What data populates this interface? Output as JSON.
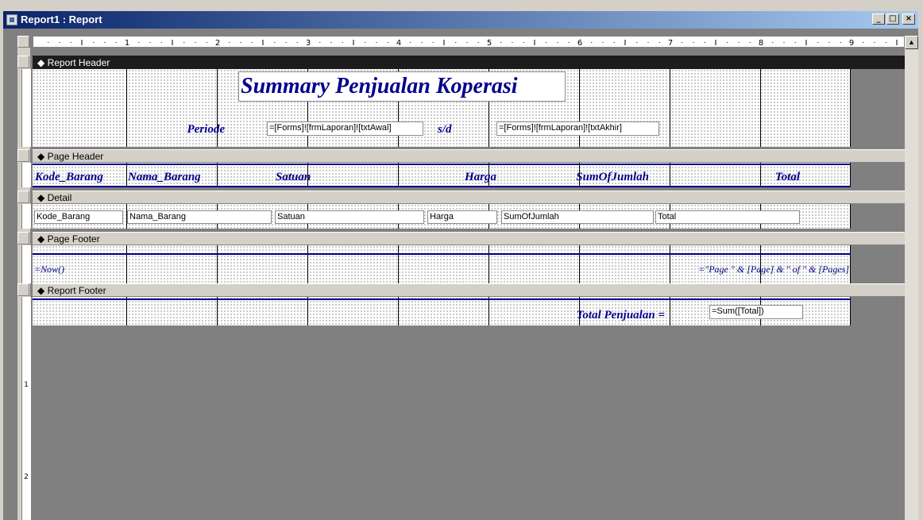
{
  "window": {
    "title": "Report1 : Report",
    "buttons": {
      "minimize": "_",
      "maximize": "□",
      "close": "×"
    }
  },
  "ruler": {
    "numbers": [
      "1",
      "2",
      "3",
      "4",
      "5",
      "6",
      "7",
      "8",
      "9"
    ]
  },
  "vertical_ruler": {
    "numbers": [
      "1",
      "2"
    ]
  },
  "sections": {
    "report_header": "Report Header",
    "page_header": "Page Header",
    "detail": "Detail",
    "page_footer": "Page Footer",
    "report_footer": "Report Footer"
  },
  "report_header": {
    "title": "Summary Penjualan Koperasi",
    "periode_label": "Periode",
    "start_field": "=[Forms]![frmLaporan]![txtAwal]",
    "sd_label": "s/d",
    "end_field": "=[Forms]![frmLaporan]![txtAkhir]"
  },
  "page_header": {
    "columns": [
      "Kode_Barang",
      "Nama_Barang",
      "Satuan",
      "Harga",
      "SumOfJumlah",
      "Total"
    ]
  },
  "detail": {
    "fields": [
      "Kode_Barang",
      "Nama_Barang",
      "Satuan",
      "Harga",
      "SumOfJumlah",
      "Total"
    ]
  },
  "page_footer": {
    "now_field": "=Now()",
    "page_field": "=\"Page \" & [Page] & \" of \" & [Pages]"
  },
  "report_footer": {
    "total_label": "Total Penjualan =",
    "sum_field": "=Sum([Total])"
  },
  "colors": {
    "title_bar_start": "#0a246a",
    "title_bar_end": "#a6caf0",
    "label_blue": "#00008b",
    "workspace_gray": "#808080"
  }
}
